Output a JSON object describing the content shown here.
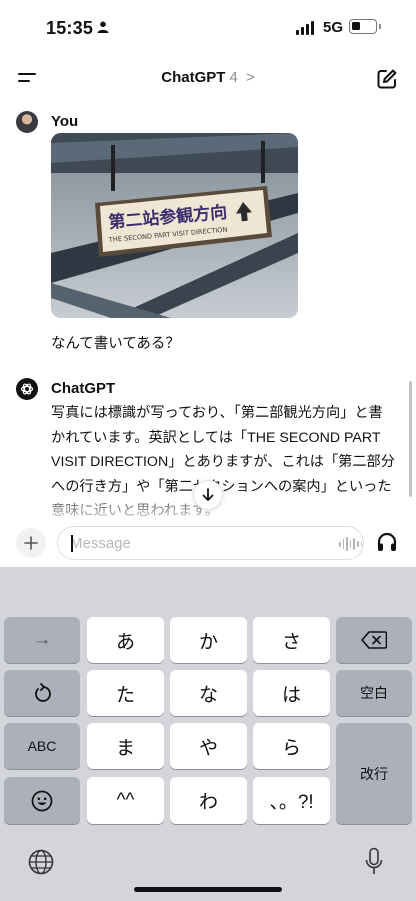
{
  "status_bar": {
    "time": "15:35",
    "network": "5G"
  },
  "nav": {
    "title": "ChatGPT",
    "version": "4",
    "version_chevron": ">"
  },
  "messages": {
    "user": {
      "name": "You",
      "sign_kanji": "第二站参観方向",
      "sign_english": "THE SECOND PART VISIT DIRECTION",
      "text": "なんて書いてある？"
    },
    "assistant": {
      "name": "ChatGPT",
      "text": "写真には標識が写っており、「第二部観光方向」と書かれています。英訳としては「THE SECOND PART VISIT DIRECTION」とありますが、これは「第二部分への行き方」や「第二セクションへの案内」といった意味に近いと思われます。"
    }
  },
  "composer": {
    "placeholder": "Message",
    "plus": "+"
  },
  "keyboard": {
    "rows": [
      [
        "→",
        "あ",
        "か",
        "さ",
        "⌫"
      ],
      [
        "↺",
        "た",
        "な",
        "は",
        "空白"
      ],
      [
        "ABC",
        "ま",
        "や",
        "ら",
        "改行"
      ],
      [
        "☺",
        "^^",
        "わ",
        "、。?!"
      ]
    ]
  },
  "colors": {
    "keyboard_bg": "#d3d5da",
    "key_light": "#ffffff",
    "key_dark": "#abb0ba",
    "accent": "#111111"
  },
  "icons": [
    "person-icon",
    "signal-icon",
    "battery-icon",
    "menu-icon",
    "chevron-right-icon",
    "compose-icon",
    "openai-logo-icon",
    "arrow-down-icon",
    "plus-icon",
    "waveform-icon",
    "headphones-icon",
    "globe-icon",
    "mic-icon",
    "delete-icon",
    "undo-icon",
    "emoji-icon"
  ]
}
